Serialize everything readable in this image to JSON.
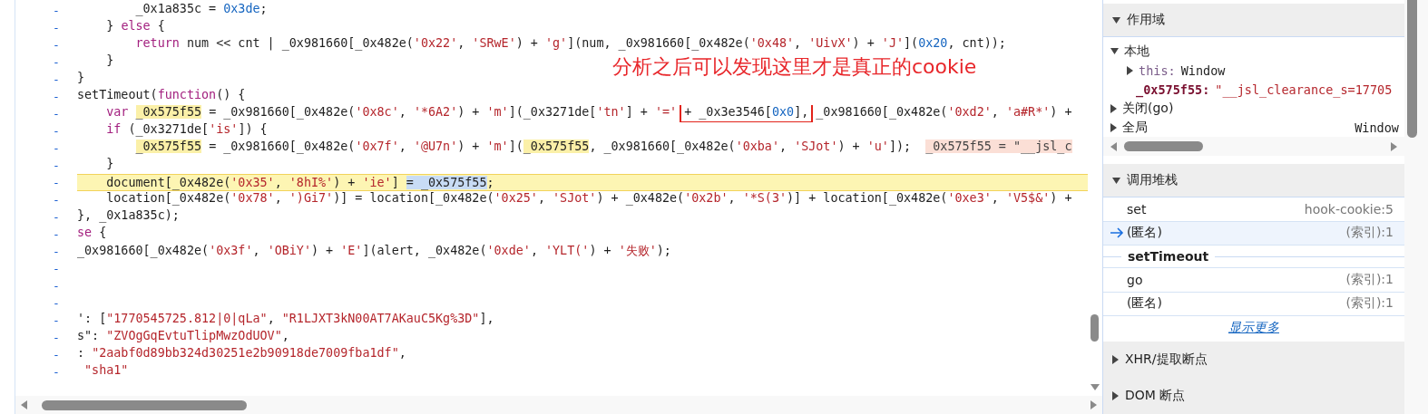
{
  "editor": {
    "annotation": {
      "text": "分析之后可以发现这里才是真正的cookie"
    },
    "lines": [
      {
        "marker": "-",
        "highlighted": false,
        "tokens": [
          {
            "kind": "p",
            "t": "        _0x1a835c = "
          },
          {
            "kind": "n",
            "t": "0x3de"
          },
          {
            "kind": "p",
            "t": ";"
          }
        ]
      },
      {
        "marker": "-",
        "highlighted": false,
        "tokens": [
          {
            "kind": "p",
            "t": "    } "
          },
          {
            "kind": "kw",
            "t": "else"
          },
          {
            "kind": "p",
            "t": " {"
          }
        ]
      },
      {
        "marker": "-",
        "highlighted": false,
        "tokens": [
          {
            "kind": "kw",
            "t": "        return"
          },
          {
            "kind": "p",
            "t": " num << cnt | _0x981660[_0x482e("
          },
          {
            "kind": "s",
            "t": "'0x22'"
          },
          {
            "kind": "p",
            "t": ", "
          },
          {
            "kind": "s",
            "t": "'SRwE'"
          },
          {
            "kind": "p",
            "t": ") + "
          },
          {
            "kind": "s",
            "t": "'g'"
          },
          {
            "kind": "p",
            "t": "](num, _0x981660[_0x482e("
          },
          {
            "kind": "s",
            "t": "'0x48'"
          },
          {
            "kind": "p",
            "t": ", "
          },
          {
            "kind": "s",
            "t": "'UivX'"
          },
          {
            "kind": "p",
            "t": ") + "
          },
          {
            "kind": "s",
            "t": "'J'"
          },
          {
            "kind": "p",
            "t": "]("
          },
          {
            "kind": "n",
            "t": "0x20"
          },
          {
            "kind": "p",
            "t": ", cnt));"
          }
        ]
      },
      {
        "marker": "-",
        "highlighted": false,
        "tokens": [
          {
            "kind": "p",
            "t": "    }"
          }
        ]
      },
      {
        "marker": "-",
        "highlighted": false,
        "tokens": [
          {
            "kind": "p",
            "t": "}"
          }
        ]
      },
      {
        "marker": "-",
        "highlighted": false,
        "tokens": [
          {
            "kind": "p",
            "t": "setTimeout("
          },
          {
            "kind": "kw",
            "t": "function"
          },
          {
            "kind": "p",
            "t": "() {"
          }
        ]
      },
      {
        "marker": "-",
        "highlighted": false,
        "tokens": [
          {
            "kind": "kw",
            "t": "    var "
          },
          {
            "kind": "v",
            "t": "_0x575f55"
          },
          {
            "kind": "p",
            "t": " = _0x981660[_0x482e("
          },
          {
            "kind": "s",
            "t": "'0x8c'"
          },
          {
            "kind": "p",
            "t": ", "
          },
          {
            "kind": "s",
            "t": "'*6A2'"
          },
          {
            "kind": "p",
            "t": ") + "
          },
          {
            "kind": "s",
            "t": "'m'"
          },
          {
            "kind": "p",
            "t": "](_0x3271de["
          },
          {
            "kind": "s",
            "t": "'tn'"
          },
          {
            "kind": "p",
            "t": "] + "
          },
          {
            "kind": "s",
            "t": "'=' "
          },
          {
            "kind": "box",
            "tokens": [
              {
                "kind": "p",
                "t": "+ _0x3e3546["
              },
              {
                "kind": "n",
                "t": "0x0"
              },
              {
                "kind": "p",
                "t": "],"
              }
            ]
          },
          {
            "kind": "p",
            "t": " _0x981660[_0x482e("
          },
          {
            "kind": "s",
            "t": "'0xd2'"
          },
          {
            "kind": "p",
            "t": ", "
          },
          {
            "kind": "s",
            "t": "'a#R*'"
          },
          {
            "kind": "p",
            "t": ") +"
          }
        ]
      },
      {
        "marker": "-",
        "highlighted": false,
        "tokens": [
          {
            "kind": "kw",
            "t": "    if"
          },
          {
            "kind": "p",
            "t": " (_0x3271de["
          },
          {
            "kind": "s",
            "t": "'is'"
          },
          {
            "kind": "p",
            "t": "]) {"
          }
        ]
      },
      {
        "marker": "-",
        "highlighted": false,
        "tokens": [
          {
            "kind": "v",
            "t": "        _0x575f55"
          },
          {
            "kind": "p",
            "t": " = _0x981660[_0x482e("
          },
          {
            "kind": "s",
            "t": "'0x7f'"
          },
          {
            "kind": "p",
            "t": ", "
          },
          {
            "kind": "s",
            "t": "'@U7n'"
          },
          {
            "kind": "p",
            "t": ") + "
          },
          {
            "kind": "s",
            "t": "'m'"
          },
          {
            "kind": "p",
            "t": "]("
          },
          {
            "kind": "v",
            "t": "_0x575f55"
          },
          {
            "kind": "p",
            "t": ", _0x981660[_0x482e("
          },
          {
            "kind": "s",
            "t": "'0xba'"
          },
          {
            "kind": "p",
            "t": ", "
          },
          {
            "kind": "s",
            "t": "'SJot'"
          },
          {
            "kind": "p",
            "t": ") + "
          },
          {
            "kind": "s",
            "t": "'u'"
          },
          {
            "kind": "p",
            "t": "]);  "
          },
          {
            "kind": "iv",
            "t": "_0x575f55 = \"__jsl_c"
          }
        ]
      },
      {
        "marker": "-",
        "highlighted": false,
        "tokens": [
          {
            "kind": "p",
            "t": "    }"
          }
        ]
      },
      {
        "marker": "-",
        "highlighted": true,
        "tokens": [
          {
            "kind": "p",
            "t": "    document[_0x482e("
          },
          {
            "kind": "s",
            "t": "'0x35'"
          },
          {
            "kind": "p",
            "t": ", "
          },
          {
            "kind": "s",
            "t": "'8hI%'"
          },
          {
            "kind": "p",
            "t": ") + "
          },
          {
            "kind": "s",
            "t": "'ie'"
          },
          {
            "kind": "p",
            "t": "] "
          },
          {
            "kind": "sel",
            "t": "= _0x575f55"
          },
          {
            "kind": "p",
            "t": ";"
          }
        ]
      },
      {
        "marker": "-",
        "highlighted": false,
        "tokens": [
          {
            "kind": "p",
            "t": "    location[_0x482e("
          },
          {
            "kind": "s",
            "t": "'0x78'"
          },
          {
            "kind": "p",
            "t": ", "
          },
          {
            "kind": "s",
            "t": "')Gi7'"
          },
          {
            "kind": "p",
            "t": ")] = location[_0x482e("
          },
          {
            "kind": "s",
            "t": "'0x25'"
          },
          {
            "kind": "p",
            "t": ", "
          },
          {
            "kind": "s",
            "t": "'SJot'"
          },
          {
            "kind": "p",
            "t": ") + _0x482e("
          },
          {
            "kind": "s",
            "t": "'0x2b'"
          },
          {
            "kind": "p",
            "t": ", "
          },
          {
            "kind": "s",
            "t": "'*S(3'"
          },
          {
            "kind": "p",
            "t": ")] + location[_0x482e("
          },
          {
            "kind": "s",
            "t": "'0xe3'"
          },
          {
            "kind": "p",
            "t": ", "
          },
          {
            "kind": "s",
            "t": "'V5$&'"
          },
          {
            "kind": "p",
            "t": ") +"
          }
        ]
      },
      {
        "marker": "-",
        "highlighted": false,
        "tokens": [
          {
            "kind": "p",
            "t": "}, _0x1a835c);"
          }
        ]
      },
      {
        "marker": "-",
        "highlighted": false,
        "tokens": [
          {
            "kind": "kw",
            "t": "se"
          },
          {
            "kind": "p",
            "t": " {"
          }
        ]
      },
      {
        "marker": "-",
        "highlighted": false,
        "tokens": [
          {
            "kind": "p",
            "t": "_0x981660[_0x482e("
          },
          {
            "kind": "s",
            "t": "'0x3f'"
          },
          {
            "kind": "p",
            "t": ", "
          },
          {
            "kind": "s",
            "t": "'OBiY'"
          },
          {
            "kind": "p",
            "t": ") + "
          },
          {
            "kind": "s",
            "t": "'E'"
          },
          {
            "kind": "p",
            "t": "](alert, _0x482e("
          },
          {
            "kind": "s",
            "t": "'0xde'"
          },
          {
            "kind": "p",
            "t": ", "
          },
          {
            "kind": "s",
            "t": "'YLT('"
          },
          {
            "kind": "p",
            "t": ") + "
          },
          {
            "kind": "s",
            "t": "'失败'"
          },
          {
            "kind": "p",
            "t": ");"
          }
        ]
      },
      {
        "marker": "-",
        "highlighted": false
      },
      {
        "marker": "-",
        "highlighted": false
      },
      {
        "marker": "-",
        "highlighted": false
      },
      {
        "marker": "-",
        "highlighted": false,
        "tokens": [
          {
            "kind": "p",
            "t": "': ["
          },
          {
            "kind": "s",
            "t": "\"1770545725.812|0|qLa\""
          },
          {
            "kind": "p",
            "t": ", "
          },
          {
            "kind": "s",
            "t": "\"R1LJXT3kN00AT7AKauC5Kg%3D\""
          },
          {
            "kind": "p",
            "t": "],"
          }
        ]
      },
      {
        "marker": "-",
        "highlighted": false,
        "tokens": [
          {
            "kind": "p",
            "t": "s\": "
          },
          {
            "kind": "s",
            "t": "\"ZVOgGqEvtuTlipMwzOdUOV\""
          },
          {
            "kind": "p",
            "t": ","
          }
        ]
      },
      {
        "marker": "-",
        "highlighted": false,
        "tokens": [
          {
            "kind": "p",
            "t": ": "
          },
          {
            "kind": "s",
            "t": "\"2aabf0d89bb324d30251e2b90918de7009fba1df\""
          },
          {
            "kind": "p",
            "t": ","
          }
        ]
      },
      {
        "marker": "-",
        "highlighted": false,
        "tokens": [
          {
            "kind": "s",
            "t": " \"sha1\""
          }
        ]
      }
    ]
  },
  "sidebar": {
    "scope": {
      "title": "作用域",
      "expanded": true,
      "items": [
        {
          "name": "本地",
          "expanded": true,
          "children": [
            {
              "kind": "object",
              "name": "this:",
              "value": "Window",
              "expanded": false
            },
            {
              "kind": "local",
              "name": "_0x575f55:",
              "value": "\"__jsl_clearance_s=17705"
            }
          ]
        },
        {
          "name": "关闭(go)",
          "expanded": false
        },
        {
          "name": "全局",
          "value": "Window",
          "expanded": false
        }
      ]
    },
    "call_stack": {
      "title": "调用堆栈",
      "expanded": true,
      "frames": [
        {
          "kind": "frame",
          "name": "set",
          "location": "hook-cookie:5",
          "selected": false
        },
        {
          "kind": "frame",
          "name": "(匿名)",
          "location": "(索引):1",
          "selected": true
        },
        {
          "kind": "async",
          "name": "setTimeout"
        },
        {
          "kind": "frame",
          "name": "go",
          "location": "(索引):1",
          "selected": false
        },
        {
          "kind": "frame",
          "name": "(匿名)",
          "location": "(索引):1",
          "selected": false
        }
      ],
      "show_more": "显示更多"
    },
    "sections": [
      {
        "title": "XHR/提取断点",
        "expanded": false
      },
      {
        "title": "DOM 断点",
        "expanded": false
      }
    ]
  }
}
